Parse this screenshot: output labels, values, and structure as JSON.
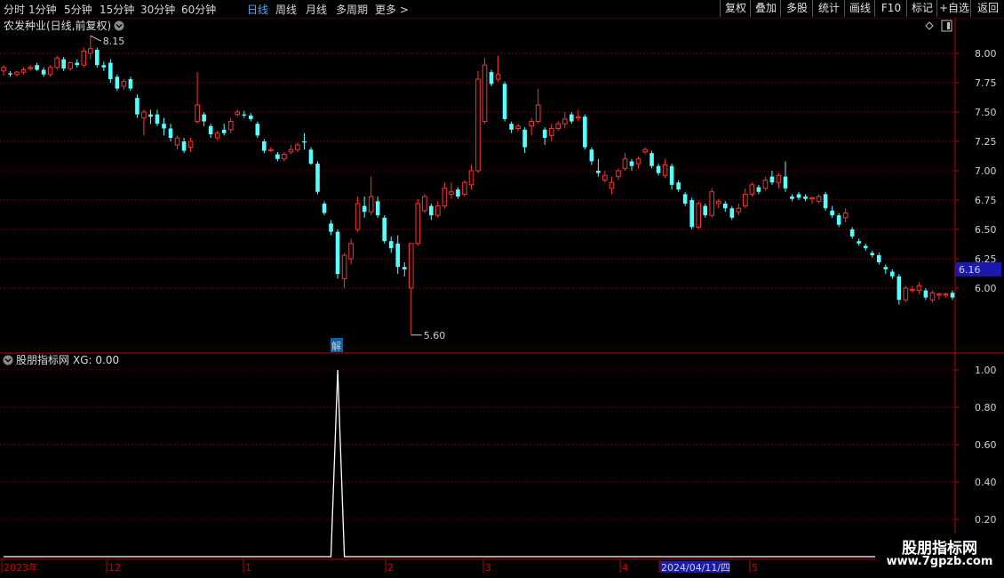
{
  "toolbar": {
    "periods": [
      "分时",
      "1分钟",
      "5分钟",
      "15分钟",
      "30分钟",
      "60分钟",
      "日线",
      "周线",
      "月线",
      "多周期",
      "更多 >"
    ],
    "active_period": "日线",
    "actions": [
      "复权",
      "叠加",
      "多股",
      "统计",
      "画线",
      "F10",
      "标记",
      "+自选",
      "返回"
    ]
  },
  "colors": {
    "up": "#ff3030",
    "down": "#54ffff",
    "grid": "#8a0000",
    "axis": "#c00000",
    "indicator": "#ffffff",
    "price_tag_bg": "#1a1ab0"
  },
  "price_panel": {
    "title": "农发种业(日线,前复权)",
    "high_marker": "8.15",
    "low_marker": "5.60",
    "current_price_tag": "6.16",
    "event_badge": "解",
    "icons": [
      "diamond-icon",
      "panel-toggle-icon"
    ]
  },
  "indicator_panel": {
    "title": "股朋指标网",
    "formula": "XG: 0.00"
  },
  "chart_data": [
    {
      "type": "candlestick",
      "title": "农发种业(日线,前复权)",
      "ylim": [
        5.55,
        8.25
      ],
      "yticks": [
        "8.00",
        "7.75",
        "7.50",
        "7.25",
        "7.00",
        "6.75",
        "6.50",
        "6.25",
        "6.00"
      ],
      "x_date_labels": [
        "2023年",
        "12",
        "1",
        "2",
        "3",
        "4",
        "2024/04/11/四",
        "5"
      ],
      "grid": true,
      "candles": [
        [
          7.85,
          7.9,
          7.81,
          7.88
        ],
        [
          7.83,
          7.85,
          7.8,
          7.82
        ],
        [
          7.82,
          7.85,
          7.8,
          7.84
        ],
        [
          7.84,
          7.88,
          7.82,
          7.86
        ],
        [
          7.87,
          7.9,
          7.85,
          7.88
        ],
        [
          7.9,
          7.92,
          7.85,
          7.86
        ],
        [
          7.86,
          7.88,
          7.8,
          7.82
        ],
        [
          7.82,
          7.9,
          7.8,
          7.88
        ],
        [
          7.88,
          7.98,
          7.86,
          7.96
        ],
        [
          7.95,
          7.97,
          7.85,
          7.87
        ],
        [
          7.87,
          7.93,
          7.85,
          7.92
        ],
        [
          7.92,
          7.95,
          7.88,
          7.9
        ],
        [
          7.9,
          8.05,
          7.88,
          8.02
        ],
        [
          8.0,
          8.15,
          7.95,
          8.04
        ],
        [
          8.03,
          8.05,
          7.88,
          7.9
        ],
        [
          7.9,
          7.93,
          7.85,
          7.88
        ],
        [
          7.92,
          7.95,
          7.75,
          7.78
        ],
        [
          7.8,
          7.82,
          7.68,
          7.7
        ],
        [
          7.72,
          7.78,
          7.69,
          7.76
        ],
        [
          7.78,
          7.8,
          7.68,
          7.7
        ],
        [
          7.62,
          7.65,
          7.45,
          7.48
        ],
        [
          7.45,
          7.52,
          7.3,
          7.5
        ],
        [
          7.48,
          7.52,
          7.4,
          7.46
        ],
        [
          7.48,
          7.52,
          7.38,
          7.4
        ],
        [
          7.4,
          7.45,
          7.3,
          7.36
        ],
        [
          7.36,
          7.4,
          7.25,
          7.28
        ],
        [
          7.22,
          7.3,
          7.18,
          7.28
        ],
        [
          7.25,
          7.28,
          7.15,
          7.17
        ],
        [
          7.2,
          7.28,
          7.16,
          7.25
        ],
        [
          7.42,
          7.84,
          7.4,
          7.56
        ],
        [
          7.48,
          7.5,
          7.38,
          7.42
        ],
        [
          7.38,
          7.4,
          7.28,
          7.31
        ],
        [
          7.28,
          7.34,
          7.26,
          7.32
        ],
        [
          7.35,
          7.4,
          7.3,
          7.32
        ],
        [
          7.35,
          7.45,
          7.32,
          7.42
        ],
        [
          7.48,
          7.52,
          7.46,
          7.5
        ],
        [
          7.48,
          7.51,
          7.45,
          7.47
        ],
        [
          7.47,
          7.49,
          7.42,
          7.44
        ],
        [
          7.4,
          7.42,
          7.28,
          7.3
        ],
        [
          7.25,
          7.27,
          7.15,
          7.17
        ],
        [
          7.17,
          7.2,
          7.16,
          7.18
        ],
        [
          7.14,
          7.16,
          7.08,
          7.1
        ],
        [
          7.1,
          7.16,
          7.08,
          7.14
        ],
        [
          7.16,
          7.22,
          7.14,
          7.18
        ],
        [
          7.18,
          7.24,
          7.16,
          7.22
        ],
        [
          7.25,
          7.32,
          7.18,
          7.24
        ],
        [
          7.18,
          7.2,
          7.05,
          7.06
        ],
        [
          7.06,
          7.08,
          6.8,
          6.82
        ],
        [
          6.72,
          6.74,
          6.62,
          6.64
        ],
        [
          6.55,
          6.58,
          6.45,
          6.48
        ],
        [
          6.48,
          6.5,
          6.08,
          6.12
        ],
        [
          6.08,
          6.3,
          6.0,
          6.28
        ],
        [
          6.25,
          6.42,
          6.2,
          6.38
        ],
        [
          6.5,
          6.78,
          6.48,
          6.72
        ],
        [
          6.7,
          6.78,
          6.6,
          6.65
        ],
        [
          6.65,
          6.95,
          6.62,
          6.78
        ],
        [
          6.74,
          6.78,
          6.6,
          6.62
        ],
        [
          6.6,
          6.62,
          6.38,
          6.4
        ],
        [
          6.4,
          6.44,
          6.3,
          6.34
        ],
        [
          6.38,
          6.45,
          6.12,
          6.18
        ],
        [
          6.18,
          6.22,
          6.1,
          6.16
        ],
        [
          6.0,
          6.18,
          5.6,
          6.38
        ],
        [
          6.38,
          6.76,
          6.36,
          6.72
        ],
        [
          6.66,
          6.8,
          6.64,
          6.78
        ],
        [
          6.7,
          6.72,
          6.58,
          6.62
        ],
        [
          6.62,
          6.74,
          6.6,
          6.7
        ],
        [
          6.7,
          6.9,
          6.68,
          6.85
        ],
        [
          6.8,
          6.9,
          6.76,
          6.82
        ],
        [
          6.84,
          6.86,
          6.76,
          6.78
        ],
        [
          6.8,
          6.92,
          6.78,
          6.9
        ],
        [
          6.88,
          7.05,
          6.84,
          7.0
        ],
        [
          7.0,
          7.85,
          6.98,
          7.78
        ],
        [
          7.42,
          7.96,
          7.4,
          7.9
        ],
        [
          7.84,
          7.86,
          7.72,
          7.74
        ],
        [
          7.78,
          7.98,
          7.76,
          7.82
        ],
        [
          7.74,
          7.76,
          7.42,
          7.44
        ],
        [
          7.4,
          7.42,
          7.32,
          7.35
        ],
        [
          7.36,
          7.4,
          7.34,
          7.38
        ],
        [
          7.35,
          7.37,
          7.15,
          7.2
        ],
        [
          7.38,
          7.45,
          7.3,
          7.42
        ],
        [
          7.42,
          7.7,
          7.4,
          7.56
        ],
        [
          7.35,
          7.37,
          7.22,
          7.28
        ],
        [
          7.3,
          7.4,
          7.25,
          7.36
        ],
        [
          7.36,
          7.42,
          7.34,
          7.4
        ],
        [
          7.4,
          7.5,
          7.36,
          7.44
        ],
        [
          7.48,
          7.5,
          7.4,
          7.42
        ],
        [
          7.45,
          7.52,
          7.42,
          7.46
        ],
        [
          7.46,
          7.48,
          7.18,
          7.2
        ],
        [
          7.18,
          7.2,
          7.05,
          7.08
        ],
        [
          7.0,
          7.1,
          6.95,
          6.98
        ],
        [
          6.92,
          7.0,
          6.9,
          6.96
        ],
        [
          6.85,
          6.95,
          6.8,
          6.9
        ],
        [
          6.95,
          7.02,
          6.92,
          7.0
        ],
        [
          7.02,
          7.15,
          7.0,
          7.1
        ],
        [
          7.08,
          7.1,
          7.0,
          7.04
        ],
        [
          7.06,
          7.12,
          7.02,
          7.1
        ],
        [
          7.16,
          7.2,
          7.14,
          7.18
        ],
        [
          7.15,
          7.17,
          7.02,
          7.04
        ],
        [
          7.04,
          7.06,
          6.96,
          6.98
        ],
        [
          6.96,
          7.1,
          6.94,
          7.05
        ],
        [
          7.04,
          7.06,
          6.84,
          6.88
        ],
        [
          6.9,
          6.92,
          6.82,
          6.84
        ],
        [
          6.8,
          6.82,
          6.7,
          6.72
        ],
        [
          6.75,
          6.77,
          6.5,
          6.52
        ],
        [
          6.52,
          6.74,
          6.5,
          6.72
        ],
        [
          6.7,
          6.72,
          6.6,
          6.62
        ],
        [
          6.62,
          6.85,
          6.6,
          6.82
        ],
        [
          6.72,
          6.76,
          6.68,
          6.74
        ],
        [
          6.72,
          6.74,
          6.65,
          6.68
        ],
        [
          6.68,
          6.7,
          6.58,
          6.6
        ],
        [
          6.65,
          6.72,
          6.62,
          6.68
        ],
        [
          6.7,
          6.85,
          6.68,
          6.8
        ],
        [
          6.8,
          6.9,
          6.78,
          6.88
        ],
        [
          6.86,
          6.88,
          6.8,
          6.82
        ],
        [
          6.85,
          6.95,
          6.83,
          6.92
        ],
        [
          6.95,
          7.0,
          6.88,
          6.9
        ],
        [
          6.9,
          6.98,
          6.85,
          6.96
        ],
        [
          6.95,
          7.08,
          6.82,
          6.85
        ],
        [
          6.78,
          6.8,
          6.74,
          6.76
        ],
        [
          6.8,
          6.82,
          6.75,
          6.77
        ],
        [
          6.78,
          6.8,
          6.74,
          6.76
        ],
        [
          6.76,
          6.78,
          6.72,
          6.77
        ],
        [
          6.74,
          6.8,
          6.72,
          6.78
        ],
        [
          6.8,
          6.82,
          6.66,
          6.68
        ],
        [
          6.66,
          6.7,
          6.6,
          6.62
        ],
        [
          6.62,
          6.64,
          6.52,
          6.54
        ],
        [
          6.6,
          6.68,
          6.56,
          6.64
        ],
        [
          6.5,
          6.52,
          6.42,
          6.44
        ],
        [
          6.4,
          6.42,
          6.36,
          6.38
        ],
        [
          6.36,
          6.38,
          6.32,
          6.34
        ],
        [
          6.3,
          6.32,
          6.26,
          6.28
        ],
        [
          6.28,
          6.3,
          6.2,
          6.22
        ],
        [
          6.18,
          6.2,
          6.12,
          6.16
        ],
        [
          6.14,
          6.16,
          6.08,
          6.1
        ],
        [
          6.1,
          6.12,
          5.86,
          5.9
        ],
        [
          5.9,
          6.02,
          5.88,
          6.0
        ],
        [
          5.98,
          6.02,
          5.96,
          5.99
        ],
        [
          5.98,
          6.05,
          5.95,
          6.02
        ],
        [
          5.98,
          6.0,
          5.9,
          5.92
        ],
        [
          5.9,
          5.98,
          5.88,
          5.96
        ],
        [
          5.94,
          5.96,
          5.9,
          5.95
        ],
        [
          5.94,
          5.96,
          5.92,
          5.95
        ],
        [
          5.96,
          5.98,
          5.9,
          5.92
        ]
      ]
    },
    {
      "type": "line",
      "title": "股朋指标网",
      "series_label": "XG",
      "ylim": [
        0.0,
        1.05
      ],
      "yticks": [
        "1.00",
        "0.80",
        "0.60",
        "0.40",
        "0.20"
      ],
      "peaks": [
        {
          "candle_index": 50,
          "value": 1.0
        }
      ]
    }
  ]
}
